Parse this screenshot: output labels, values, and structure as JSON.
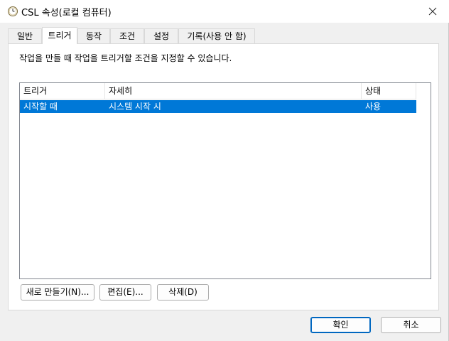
{
  "window": {
    "title": "CSL 속성(로컬 컴퓨터)",
    "close_icon": "close-icon",
    "title_icon": "clock-icon"
  },
  "tabs": [
    {
      "label": "일반"
    },
    {
      "label": "트리거",
      "active": true
    },
    {
      "label": "동작"
    },
    {
      "label": "조건"
    },
    {
      "label": "설정"
    },
    {
      "label": "기록(사용 안 함)"
    }
  ],
  "triggers_tab": {
    "description": "작업을 만들 때 작업을 트리거할 조건을 지정할 수 있습니다.",
    "columns": [
      "트리거",
      "자세히",
      "상태"
    ],
    "rows": [
      {
        "trigger": "시작할 때",
        "details": "시스템 시작 시",
        "status": "사용",
        "selected": true
      }
    ],
    "buttons": {
      "new": "새로 만들기(N)...",
      "edit": "편집(E)...",
      "delete": "삭제(D)"
    }
  },
  "footer": {
    "ok": "확인",
    "cancel": "취소"
  },
  "colors": {
    "selection": "#0078d7",
    "default_button_border": "#0067c0"
  }
}
